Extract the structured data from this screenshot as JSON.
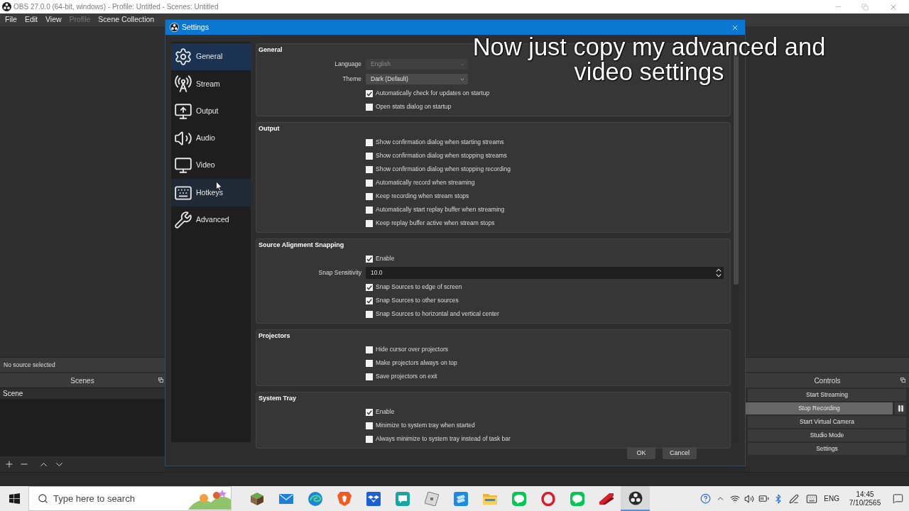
{
  "window": {
    "title": "OBS 27.0.0 (64-bit, windows) - Profile: Untitled - Scenes: Untitled"
  },
  "menu": [
    {
      "label": "File",
      "disabled": false
    },
    {
      "label": "Edit",
      "disabled": false
    },
    {
      "label": "View",
      "disabled": false
    },
    {
      "label": "Profile",
      "disabled": true
    },
    {
      "label": "Scene Collection",
      "disabled": false
    }
  ],
  "source_bar": {
    "label": "No source selected"
  },
  "scenes": {
    "title": "Scenes",
    "items": [
      {
        "label": "Scene",
        "selected": true
      }
    ]
  },
  "controls": {
    "title": "Controls",
    "buttons": [
      {
        "label": "Start Streaming",
        "checked": false
      },
      {
        "label": "Stop Recording",
        "checked": true
      },
      {
        "label": "Start Virtual Camera",
        "checked": false
      },
      {
        "label": "Studio Mode",
        "checked": false
      },
      {
        "label": "Settings",
        "checked": false
      }
    ]
  },
  "settings": {
    "title": "Settings",
    "nav": [
      {
        "label": "General",
        "kind": "gear",
        "selected": true,
        "hovered": false
      },
      {
        "label": "Stream",
        "kind": "antenna",
        "selected": false,
        "hovered": false
      },
      {
        "label": "Output",
        "kind": "monitor-arrow",
        "selected": false,
        "hovered": false
      },
      {
        "label": "Audio",
        "kind": "speaker",
        "selected": false,
        "hovered": false
      },
      {
        "label": "Video",
        "kind": "monitor",
        "selected": false,
        "hovered": false
      },
      {
        "label": "Hotkeys",
        "kind": "keyboard",
        "selected": false,
        "hovered": true
      },
      {
        "label": "Advanced",
        "kind": "tools",
        "selected": false,
        "hovered": false
      }
    ],
    "groups": [
      {
        "title": "General",
        "rows": [
          {
            "kind": "combo",
            "label": "Language",
            "value": "English",
            "disabled": true
          },
          {
            "kind": "combo",
            "label": "Theme",
            "value": "Dark (Default)",
            "disabled": false
          },
          {
            "kind": "checkbox",
            "label": "Automatically check for updates on startup",
            "checked": true
          },
          {
            "kind": "checkbox",
            "label": "Open stats dialog on startup",
            "checked": false
          }
        ]
      },
      {
        "title": "Output",
        "rows": [
          {
            "kind": "checkbox",
            "label": "Show confirmation dialog when starting streams",
            "checked": false
          },
          {
            "kind": "checkbox",
            "label": "Show confirmation dialog when stopping streams",
            "checked": false
          },
          {
            "kind": "checkbox",
            "label": "Show confirmation dialog when stopping recording",
            "checked": false
          },
          {
            "kind": "checkbox",
            "label": "Automatically record when streaming",
            "checked": false
          },
          {
            "kind": "checkbox",
            "label": "Keep recording when stream stops",
            "checked": false
          },
          {
            "kind": "checkbox",
            "label": "Automatically start replay buffer when streaming",
            "checked": false
          },
          {
            "kind": "checkbox",
            "label": "Keep replay buffer active when stream stops",
            "checked": false
          }
        ]
      },
      {
        "title": "Source Alignment Snapping",
        "rows": [
          {
            "kind": "checkbox",
            "label": "Enable",
            "checked": true
          },
          {
            "kind": "spin",
            "label": "Snap Sensitivity",
            "value": "10.0"
          },
          {
            "kind": "checkbox",
            "label": "Snap Sources to edge of screen",
            "checked": true
          },
          {
            "kind": "checkbox",
            "label": "Snap Sources to other sources",
            "checked": true
          },
          {
            "kind": "checkbox",
            "label": "Snap Sources to horizontal and vertical center",
            "checked": false
          }
        ]
      },
      {
        "title": "Projectors",
        "rows": [
          {
            "kind": "checkbox",
            "label": "Hide cursor over projectors",
            "checked": false
          },
          {
            "kind": "checkbox",
            "label": "Make projectors always on top",
            "checked": false
          },
          {
            "kind": "checkbox",
            "label": "Save projectors on exit",
            "checked": false
          }
        ]
      },
      {
        "title": "System Tray",
        "rows": [
          {
            "kind": "checkbox",
            "label": "Enable",
            "checked": true
          },
          {
            "kind": "checkbox",
            "label": "Minimize to system tray when started",
            "checked": false
          },
          {
            "kind": "checkbox",
            "label": "Always minimize to system tray instead of task bar",
            "checked": false
          }
        ]
      }
    ],
    "buttons": [
      "OK",
      "Cancel"
    ]
  },
  "caption": "Now just copy my advanced and video settings",
  "taskbar": {
    "search": {
      "placeholder": "Type here to search"
    },
    "apps": [
      {
        "kind": "cube",
        "active": false
      },
      {
        "kind": "mail",
        "active": false
      },
      {
        "kind": "swirl",
        "active": false
      },
      {
        "kind": "shield",
        "active": false
      },
      {
        "kind": "box",
        "active": false
      },
      {
        "kind": "chat",
        "active": false
      },
      {
        "kind": "tilted-square",
        "active": false
      },
      {
        "kind": "stack",
        "active": false
      },
      {
        "kind": "folder",
        "active": false
      },
      {
        "kind": "bubble",
        "active": false
      },
      {
        "kind": "ring",
        "active": false
      },
      {
        "kind": "bubble",
        "active": false
      },
      {
        "kind": "claw",
        "active": false
      },
      {
        "kind": "logo",
        "active": true
      }
    ],
    "tray": {
      "language": "ENG",
      "time": "14:45",
      "date": "7/10/2565"
    }
  }
}
